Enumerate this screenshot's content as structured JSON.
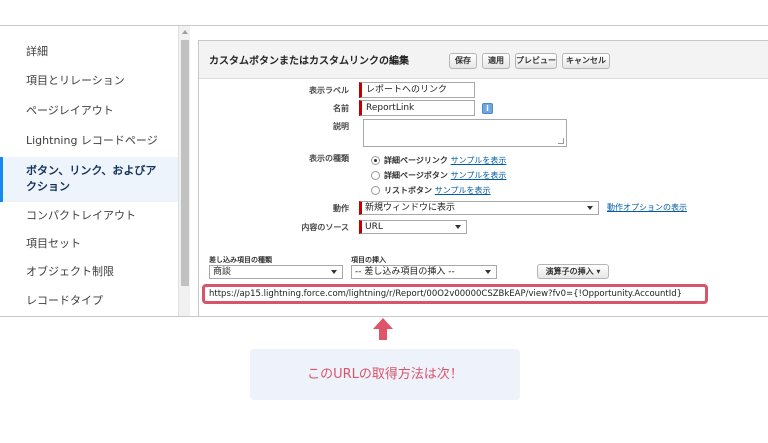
{
  "sidebar": {
    "items": [
      {
        "label": "詳細"
      },
      {
        "label": "項目とリレーション"
      },
      {
        "label": "ページレイアウト"
      },
      {
        "label": "Lightning レコードページ"
      },
      {
        "label": "ボタン、リンク、およびア\nクション"
      },
      {
        "label": "コンパクトレイアウト"
      },
      {
        "label": "項目セット"
      },
      {
        "label": "オブジェクト制限"
      },
      {
        "label": "レコードタイプ"
      }
    ]
  },
  "editor": {
    "title": "カスタムボタンまたはカスタムリンクの編集",
    "buttons": {
      "save": "保存",
      "apply": "適用",
      "preview": "プレビュー",
      "cancel": "キャンセル"
    },
    "fields": {
      "display_label": {
        "label": "表示ラベル",
        "value": "レポートへのリンク"
      },
      "name": {
        "label": "名前",
        "value": "ReportLink"
      },
      "description": {
        "label": "説明",
        "value": ""
      },
      "display_type": {
        "label": "表示の種類",
        "options": [
          {
            "text": "詳細ページリンク",
            "link": "サンプルを表示",
            "selected": true
          },
          {
            "text": "詳細ページボタン",
            "link": "サンプルを表示",
            "selected": false
          },
          {
            "text": "リストボタン",
            "link": "サンプルを表示",
            "selected": false
          }
        ]
      },
      "behavior": {
        "label": "動作",
        "value": "新規ウィンドウに表示",
        "link": "動作オプションの表示"
      },
      "content_source": {
        "label": "内容のソース",
        "value": "URL"
      }
    },
    "merge": {
      "type_label": "差し込み項目の種類",
      "type_value": "商談",
      "insert_label": "項目の挿入",
      "insert_value": "-- 差し込み項目の挿入 --",
      "operator_button": "演算子の挿入"
    },
    "url": "https://ap15.lightning.force.com/lightning/r/Report/00O2v00000CSZBkEAP/view?fv0={!Opportunity.AccountId}"
  },
  "callout": {
    "text": "このURLの取得方法は次！"
  },
  "colors": {
    "highlight": "#d8546a",
    "callout_bg": "#eef3fb",
    "required": "#c00000"
  }
}
